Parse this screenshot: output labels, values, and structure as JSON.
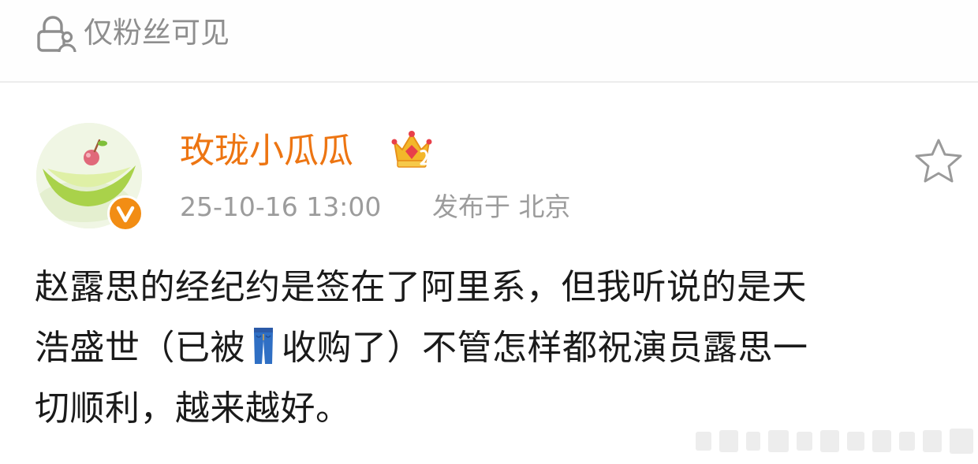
{
  "visibility": {
    "icon": "lock-person-icon",
    "label": "仅粉丝可见"
  },
  "post": {
    "author": {
      "name": "玫珑小瓜瓜",
      "avatar": "melon-avatar",
      "verified_badge": "orange-v-badge",
      "level_badge": "crown-2-icon"
    },
    "timestamp": "25-10-16 13:00",
    "location": "发布于 北京",
    "favorite_icon": "star-outline-icon",
    "body_lines": [
      "赵露思的经纪约是签在了阿里系，但我听说的是天",
      "浩盛世（已被",
      "收购了）不管怎样都祝演员露思一",
      "切顺利，越来越好。"
    ],
    "inline_emoji": "jeans-icon"
  },
  "colors": {
    "author_name": "#ed7512",
    "meta_text": "#9c9c9c",
    "body_text": "#1a1a1a",
    "badge": "#f28d14"
  }
}
